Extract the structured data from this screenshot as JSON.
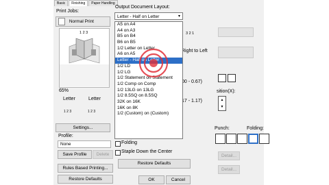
{
  "tabs": [
    "Basic",
    "Finishing",
    "Paper Handling"
  ],
  "print_jobs": {
    "label": "Print Jobs:",
    "normal_print": "Normal Print"
  },
  "preview": {
    "pages": "1 2 3",
    "zoom": "65%",
    "left_label": "Letter",
    "right_label": "Letter",
    "left_pages": "1 2 3",
    "right_pages": "1 2 3"
  },
  "buttons": {
    "settings": "Settings...",
    "save_profile": "Save Profile",
    "delete": "Delete",
    "rules_based_printing": "Rules Based Printing...",
    "restore_defaults_left": "Restore Defaults",
    "restore_defaults_center": "Restore Defaults",
    "ok": "OK",
    "cancel": "Cancel",
    "detail_1": "Detail...",
    "detail_2": "Detail..."
  },
  "profile": {
    "label": "Profile:",
    "value": "None"
  },
  "output_layout": {
    "label": "Output Document Layout:",
    "selected": "Letter - Half on Letter",
    "options": [
      "A5 on A4",
      "A4 on A3",
      "B5 on B4",
      "B6 on B5",
      "1/2 Letter on Letter",
      "A6 on A5",
      "Letter - Half on Letter",
      "1/2 LD",
      "1/2 LG",
      "1/2 Statement on Statement",
      "1/2 Comp on Comp",
      "1/2 13LG on 13LG",
      "1/2 8.5SQ on 8.5SQ",
      "32K on 16K",
      "16K on 8K",
      "1/2 (Custom) on (Custom)"
    ],
    "selected_index": 6
  },
  "behind_text": {
    "pages_hint": "3 2 1",
    "right_to_left": "Right to Left",
    "range_1": "00 - 0.67)",
    "range_2": "17 - 1.17)",
    "position": "sition(X):",
    "punch": "Punch:",
    "folding_label": "Folding:"
  },
  "checkboxes": {
    "folding": "Folding",
    "staple_down_center": "Staple Down the Center"
  }
}
